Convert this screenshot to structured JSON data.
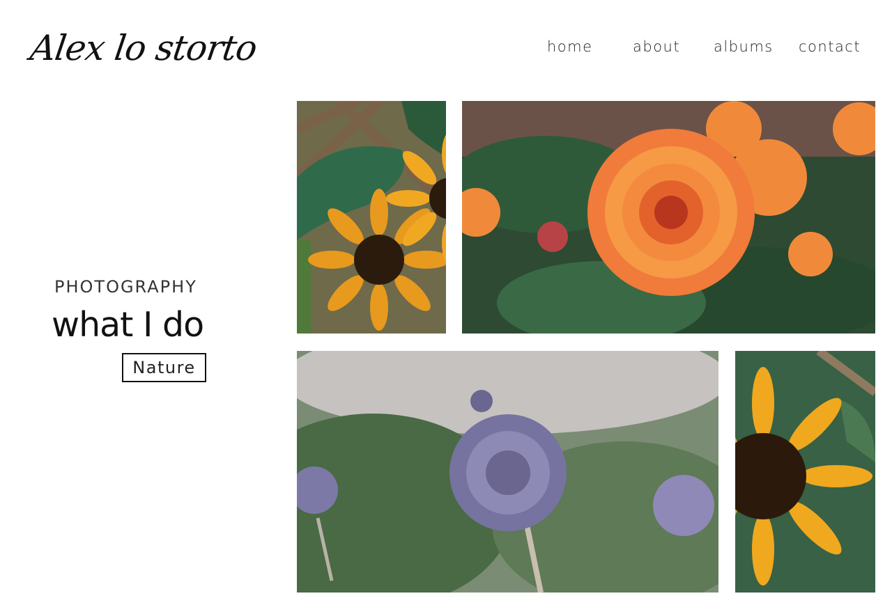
{
  "brand": {
    "name": "Alex lo storto"
  },
  "nav": {
    "items": [
      "home",
      "about",
      "albums",
      "contact"
    ]
  },
  "hero": {
    "eyebrow": "PHOTOGRAPHY",
    "title": "what I do",
    "tag": "Nature"
  },
  "colors": {
    "background": "#ffffff",
    "text": "#111111"
  },
  "gallery": [
    {
      "subject": "sunflowers"
    },
    {
      "subject": "orange dahlia"
    },
    {
      "subject": "globe thistle"
    },
    {
      "subject": "sunflower"
    }
  ]
}
